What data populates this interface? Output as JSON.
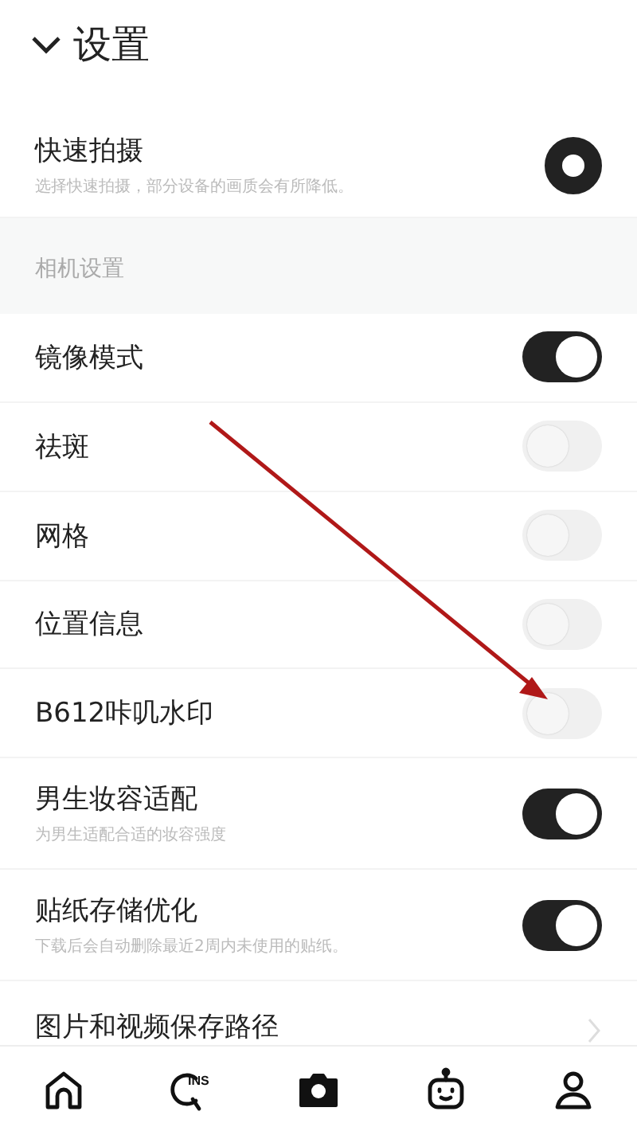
{
  "header": {
    "title": "设置"
  },
  "quick_capture": {
    "label": "快速拍摄",
    "description": "选择快速拍摄，部分设备的画质会有所降低。",
    "selected": true
  },
  "section": {
    "title": "相机设置"
  },
  "settings": [
    {
      "label": "镜像模式",
      "on": true
    },
    {
      "label": "祛斑",
      "on": false
    },
    {
      "label": "网格",
      "on": false
    },
    {
      "label": "位置信息",
      "on": false
    },
    {
      "label": "B612咔叽水印",
      "on": false
    },
    {
      "label": "男生妆容适配",
      "description": "为男生适配合适的妆容强度",
      "on": true
    },
    {
      "label": "贴纸存储优化",
      "description": "下载后会自动删除最近2周内未使用的贴纸。",
      "on": true
    }
  ],
  "link_row": {
    "label": "图片和视频保存路径"
  },
  "nav": [
    {
      "kind": "home"
    },
    {
      "kind": "search",
      "badge": "INS"
    },
    {
      "kind": "camera"
    },
    {
      "kind": "robot"
    },
    {
      "kind": "profile"
    }
  ]
}
